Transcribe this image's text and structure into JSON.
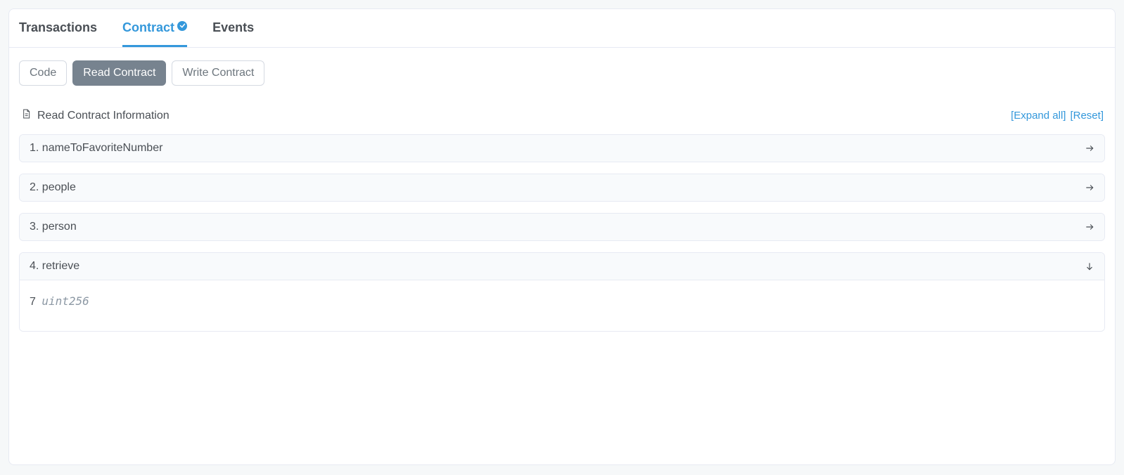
{
  "tabs": {
    "transactions": "Transactions",
    "contract": "Contract",
    "events": "Events"
  },
  "subtabs": {
    "code": "Code",
    "read": "Read Contract",
    "write": "Write Contract"
  },
  "section": {
    "title": "Read Contract Information",
    "expand": "[Expand all]",
    "reset": "[Reset]"
  },
  "methods": [
    {
      "label": "1. nameToFavoriteNumber",
      "expanded": false
    },
    {
      "label": "2. people",
      "expanded": false
    },
    {
      "label": "3. person",
      "expanded": false
    },
    {
      "label": "4. retrieve",
      "expanded": true,
      "value": "7",
      "type": "uint256"
    }
  ]
}
